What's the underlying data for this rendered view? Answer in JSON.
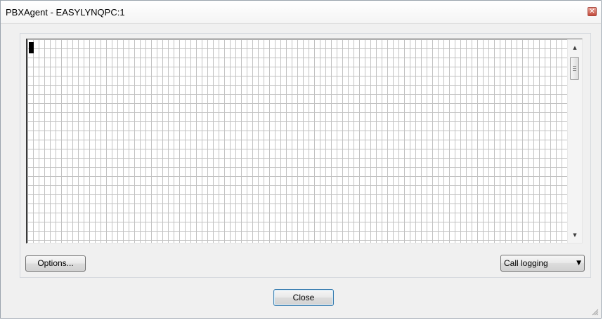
{
  "window": {
    "title": "PBXAgent - EASYLYNQPC:1",
    "close_glyph": "✕"
  },
  "console": {
    "scroll_up_glyph": "▲",
    "scroll_down_glyph": "▼"
  },
  "controls": {
    "options_label": "Options...",
    "mode_select_value": "Call logging",
    "mode_select_arrow": "▼",
    "close_label": "Close"
  },
  "colors": {
    "window_bg": "#f0f0f0",
    "grid_line": "#c2c2c2",
    "default_button_border": "#3c7fb1",
    "close_icon": "#c2493a"
  },
  "icons": {
    "window_close": "close-icon",
    "scroll_up": "scroll-up-arrow-icon",
    "scroll_down": "scroll-down-arrow-icon",
    "dropdown": "chevron-down-icon",
    "resize": "resize-grip-icon"
  }
}
